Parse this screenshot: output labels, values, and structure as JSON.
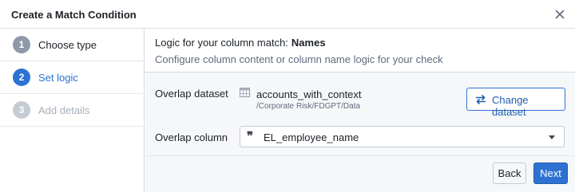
{
  "dialog": {
    "title": "Create a Match Condition"
  },
  "steps": [
    {
      "number": "1",
      "label": "Choose type",
      "state": "done"
    },
    {
      "number": "2",
      "label": "Set logic",
      "state": "active"
    },
    {
      "number": "3",
      "label": "Add details",
      "state": "future"
    }
  ],
  "logic": {
    "prefix": "Logic for your column match:",
    "match_name": "Names",
    "subtitle": "Configure column content or column name logic for your check"
  },
  "overlap_dataset": {
    "label": "Overlap dataset",
    "icon": "table-icon",
    "name": "accounts_with_context",
    "path": "/Corporate Risk/FDGPT/Data",
    "change_button": "Change dataset",
    "change_icon": "swap-arrows-icon"
  },
  "overlap_column": {
    "label": "Overlap column",
    "icon": "quote-icon",
    "quote_glyph": "❞",
    "value": "EL_employee_name"
  },
  "footer": {
    "back_label": "Back",
    "next_label": "Next"
  },
  "colors": {
    "accent": "#2d72d2",
    "step_done": "#8f99a8",
    "step_future": "#c5cbd3",
    "panel_bg": "#f6f7f9"
  }
}
